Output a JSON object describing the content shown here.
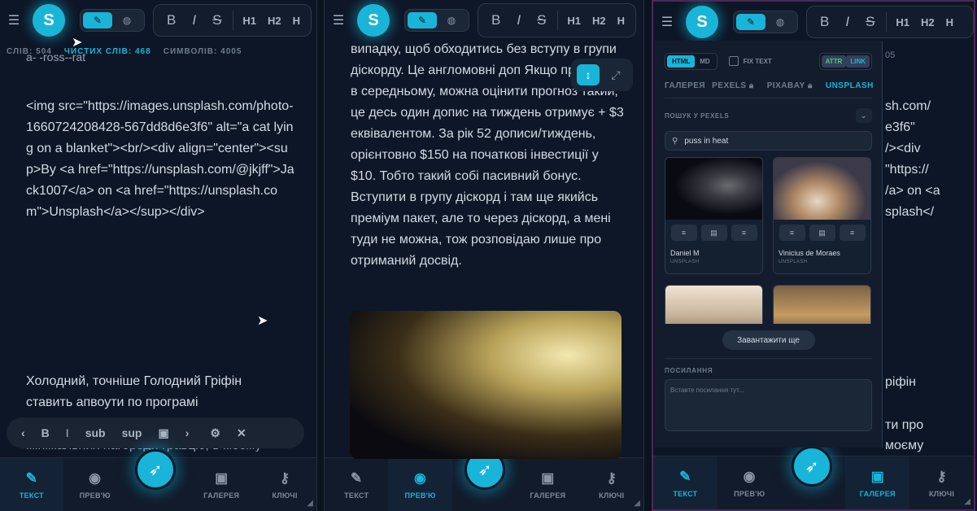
{
  "app": {
    "logo_letter": "S"
  },
  "toolbar": {
    "bold": "B",
    "italic": "I",
    "strike": "S",
    "h1": "H1",
    "h2": "H2",
    "h3": "H"
  },
  "icons": {
    "menu": "hamburger-icon",
    "edit": "pencil-icon",
    "preview": "globe-icon",
    "rocket": "rocket-icon",
    "expand": "expand-icon",
    "resize": "resize-icon"
  },
  "stats": {
    "words": "СЛІВ: 504",
    "clean_words": "ЧИСТИХ СЛІВ: 468",
    "chars": "СИМВОЛІВ: 4005"
  },
  "pane1": {
    "text_top": "a- -ross--rat",
    "code": "<img src=\"https://images.unsplash.com/photo-1660724208428-567dd8d6e3f6\" alt=\"a cat lying on a blanket\"><br/><div align=\"center\"><sup>By <a href=\"https://unsplash.com/@jkjff\">Jack1007</a> on <a href=\"https://unsplash.com\">Unsplash</a></sup></div>",
    "para": "Холодний, точніше Голодний Гріфін ставить апвоути по програмі",
    "para_cut": "мінімальних нагороди гравцю, в моєму",
    "floatbar": {
      "bold": "B",
      "italic": "I",
      "sub": "sub",
      "sup": "sup"
    }
  },
  "pane2": {
    "text": "випадку, щоб обходитись без вступу в групи діскорду. Це англомовні доп Якщо прикинути в середньому, можна оцінити прогноз такий, це десь один допис на тиждень отримує + $3 еквівалентом. За рік 52 дописи/тиждень, орієнтовно $150 на початкові інвестиції у $10. Тобто такий собі пасивний бонус. Вступити в групу діскорд і там ще якийсь преміум пакет, але то через діскорд, а мені туди не можна, тож розповідаю лише про отриманий досвід."
  },
  "pane3": {
    "bg_fragments": [
      "sh.com/",
      "e3f6\"",
      "/><div",
      "\"https://",
      "/a> on <a",
      "splash</",
      "05",
      "ріфін",
      "ти про",
      "моєму"
    ],
    "popup": {
      "html": "HTML",
      "md": "MD",
      "fix_text": "FIX TEXT",
      "attr": "ATTR",
      "link": "LINK",
      "tabs": [
        "ГАЛЕРЕЯ",
        "PEXELS",
        "PIXABAY",
        "UNSPLASH"
      ],
      "search_title": "ПОШУК У PEXELS",
      "search_value": "puss in heat",
      "cards": [
        {
          "author": "Daniel M",
          "source": "UNSPLASH"
        },
        {
          "author": "Vinicius de Moraes",
          "source": "UNSPLASH"
        }
      ],
      "load_more": "Завантажити ще",
      "links_title": "ПОСИЛАННЯ",
      "links_placeholder": "Вставте посилання тут..."
    }
  },
  "nav": {
    "text": "ТЕКСТ",
    "preview": "ПРЕВ'Ю",
    "gallery": "ГАЛЕРЕЯ",
    "keys": "КЛЮЧІ"
  },
  "colors": {
    "accent": "#19b5d9",
    "bg": "#0d1626"
  }
}
